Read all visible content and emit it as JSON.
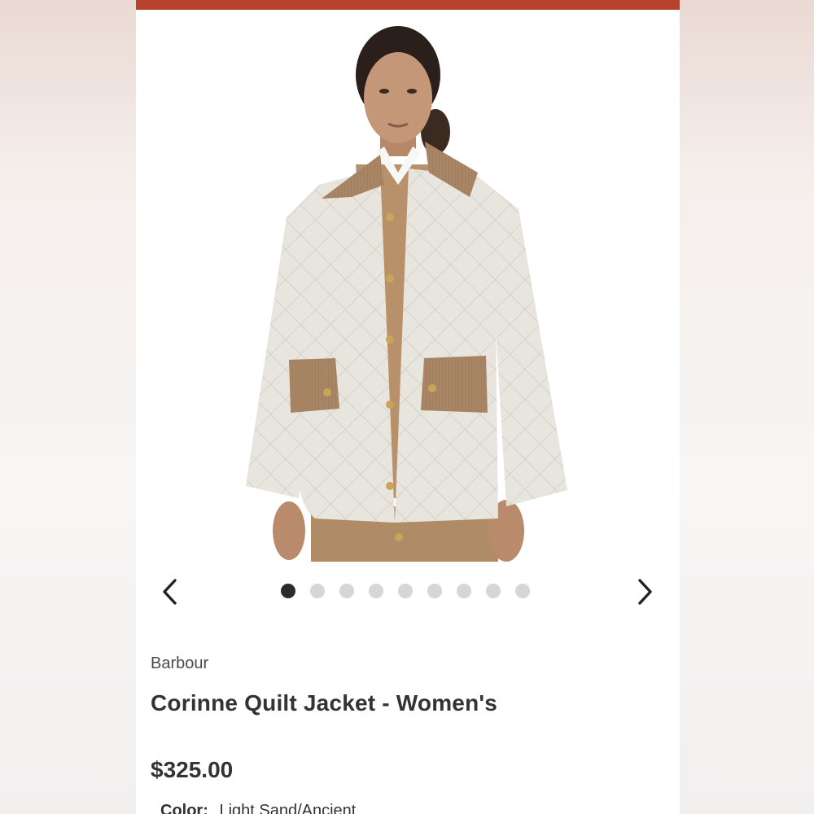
{
  "theme": {
    "accent": "#b7412a",
    "inactive_dot": "#d6d6d6",
    "active_dot": "#2b2b2b"
  },
  "product": {
    "brand": "Barbour",
    "title": "Corinne Quilt Jacket - Women's",
    "price": "$325.00",
    "color_label": "Color:",
    "color_value": "Light Sand/Ancient"
  },
  "gallery": {
    "image_icon": "product-photo",
    "prev_icon": "chevron-left-icon",
    "next_icon": "chevron-right-icon",
    "total_images": 9,
    "active_index": 0
  }
}
